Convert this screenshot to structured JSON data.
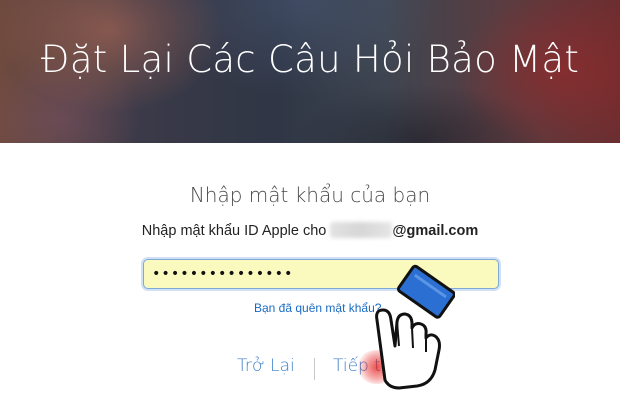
{
  "header": {
    "title": "Đặt Lại Các Câu Hỏi Bảo Mật"
  },
  "form": {
    "heading": "Nhập mật khẩu của bạn",
    "instruction_prefix": "Nhập mật khẩu ID Apple cho",
    "email_domain": "@gmail.com",
    "password_value": "•••••••••••••••",
    "forgot_link": "Bạn đã quên mật khẩu?"
  },
  "actions": {
    "back_label": "Trở Lại",
    "continue_label": "Tiếp tục"
  },
  "colors": {
    "link": "#3f7fc7",
    "field_bg": "#fafabf",
    "click_highlight": "#e61414"
  }
}
